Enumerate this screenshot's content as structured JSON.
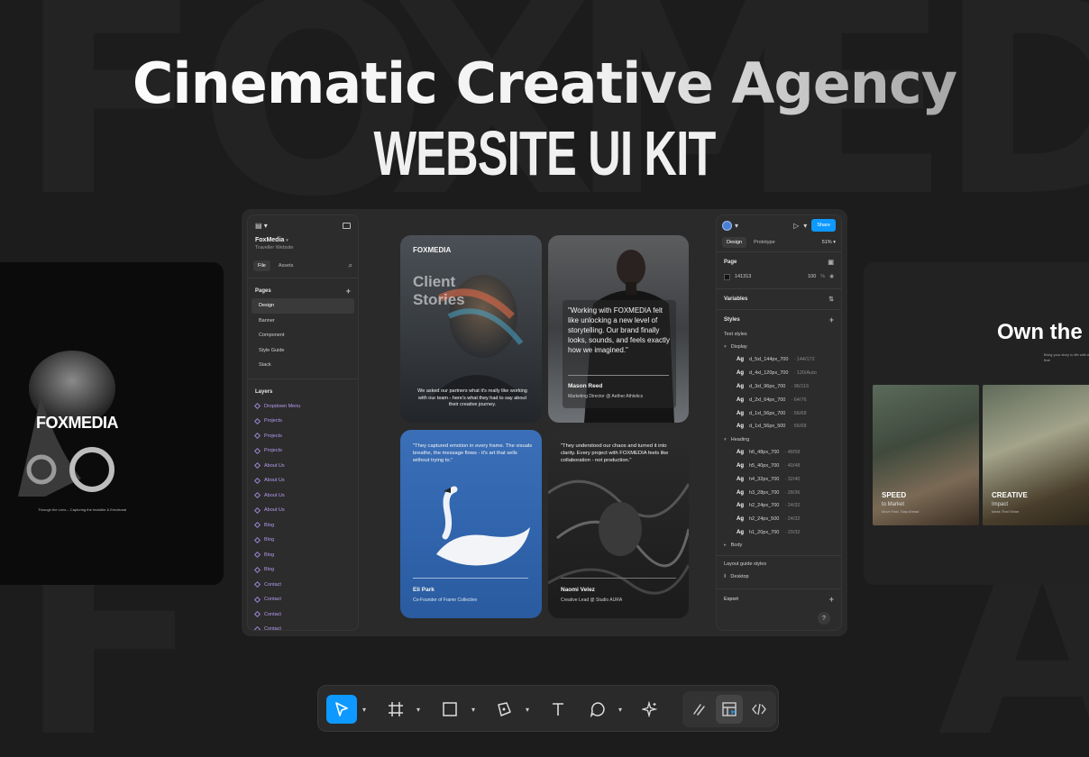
{
  "hero": {
    "title": "Cinematic Creative Agency",
    "subtitle": "WEBSITE UI KIT"
  },
  "left_preview": {
    "brand": "FOXMEDIA",
    "tagline": "Through the Lens – Capturing the Invisible & Emotional"
  },
  "right_preview": {
    "heading": "Own the",
    "subtext": "Bring your story to life with engaging content that",
    "photo1": {
      "label": "SPEED",
      "sub": "to Market",
      "tiny": "Move Fast, Stay Ahead"
    },
    "photo2": {
      "label": "CREATIVE",
      "sub": "Impact",
      "tiny": "Ideas That Shine"
    }
  },
  "left_panel": {
    "project_name": "FoxMedia",
    "project_sub": "Traveller Website",
    "tabs": [
      "File",
      "Assets"
    ],
    "pages_title": "Pages",
    "pages": [
      "Design",
      "Banner",
      "Component",
      "Style Guide",
      "Stack"
    ],
    "layers_title": "Layers",
    "layers": [
      "Dropdown Menu",
      "Projects",
      "Projects",
      "Projects",
      "About Us",
      "About Us",
      "About Us",
      "About Us",
      "Blog",
      "Blog",
      "Blog",
      "Blog",
      "Contact",
      "Contact",
      "Contact",
      "Contact"
    ]
  },
  "right_panel": {
    "share": "Share",
    "tabs": [
      "Design",
      "Prototype"
    ],
    "zoom": "51%",
    "page_title": "Page",
    "page_color": "141313",
    "page_opacity": "100",
    "page_percent": "%",
    "variables": "Variables",
    "styles": "Styles",
    "text_styles": "Text styles",
    "display_group": "Display",
    "display_styles": [
      {
        "name": "d_5xl_144px_700",
        "meta": "· 144/172"
      },
      {
        "name": "d_4xl_120px_700",
        "meta": "· 120/Auto"
      },
      {
        "name": "d_3xl_96px_700",
        "meta": "· 96/116"
      },
      {
        "name": "d_2xl_64px_700",
        "meta": "· 64/76"
      },
      {
        "name": "d_1xl_56px_700",
        "meta": "· 56/68"
      },
      {
        "name": "d_1xl_56px_500",
        "meta": "· 56/68"
      }
    ],
    "heading_group": "Heading",
    "heading_styles": [
      {
        "name": "h6_48px_700",
        "meta": "· 48/58"
      },
      {
        "name": "h5_40px_700",
        "meta": "· 40/48"
      },
      {
        "name": "h4_32px_700",
        "meta": "· 32/40"
      },
      {
        "name": "h3_28px_700",
        "meta": "· 28/36"
      },
      {
        "name": "h2_24px_700",
        "meta": "· 24/32"
      },
      {
        "name": "h2_24px_500",
        "meta": "· 24/32"
      },
      {
        "name": "h1_20px_700",
        "meta": "· 20/32"
      }
    ],
    "body_group": "Body",
    "ag": "Ag",
    "layout_guides": "Layout guide styles",
    "desktop": "Desktop",
    "export": "Export",
    "help": "?"
  },
  "canvas_cards": {
    "card1": {
      "brand": "FOXMEDIA",
      "title_line1": "Client",
      "title_line2": "Stories",
      "body": "We asked our partners what it's really like working with our team - here's what they had to say about their creative journey."
    },
    "card2": {
      "quote": "\"Working with FOXMEDIA felt like unlocking a new level of storytelling. Our brand finally looks, sounds, and feels exactly how we imagined.\"",
      "name": "Mason Reed",
      "role": "Marketing Director @ Aether Athletics"
    },
    "card3": {
      "quote": "\"They captured emotion in every frame. The visuals breathe, the message flows - it's art that sells without trying to.\"",
      "name": "Eli Park",
      "role": "Co-Founder of Frame Collective"
    },
    "card4": {
      "quote": "\"They understood our chaos and turned it into clarity. Every project with FOXMEDIA feels like collaboration - not production.\"",
      "name": "Naomi Velez",
      "role": "Creative Lead @ Studio AURA"
    }
  },
  "colors": {
    "accent": "#0d99ff",
    "layer_purple": "#b59cf0"
  },
  "toolbar": {
    "tools": [
      "move-tool",
      "frame-tool",
      "rectangle-tool",
      "pen-tool",
      "text-tool",
      "comment-tool",
      "ai-tool"
    ],
    "modes": [
      "draw-mode",
      "design-mode",
      "dev-mode"
    ]
  }
}
